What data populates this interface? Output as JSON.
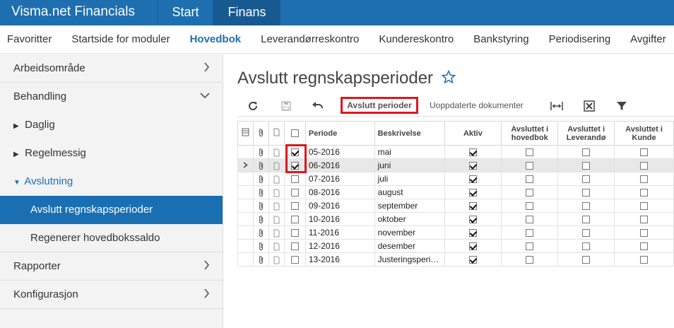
{
  "app": {
    "title": "Visma.net Financials",
    "tabs": [
      "Start",
      "Finans"
    ]
  },
  "module_nav": [
    "Favoritter",
    "Startside for moduler",
    "Hovedbok",
    "Leverandørreskontro",
    "Kundereskontro",
    "Bankstyring",
    "Periodisering",
    "Avgifter"
  ],
  "sidebar": {
    "arbeidsomrade": "Arbeidsområde",
    "behandling": "Behandling",
    "daglig": "Daglig",
    "regelmessig": "Regelmessig",
    "avslutning": "Avslutning",
    "avslutt_regnskapsperioder": "Avslutt regnskapsperioder",
    "regenerer": "Regenerer hovedbokssaldo",
    "rapporter": "Rapporter",
    "konfigurasjon": "Konfigurasjon"
  },
  "page": {
    "title": "Avslutt regnskapsperioder"
  },
  "toolbar": {
    "avslutt_perioder": "Avslutt perioder",
    "uoppdaterte": "Uoppdaterte dokumenter"
  },
  "grid": {
    "headers": {
      "periode": "Periode",
      "beskrivelse": "Beskrivelse",
      "aktiv": "Aktiv",
      "hovedbok_line1": "Avsluttet i",
      "hovedbok_line2": "hovedbok",
      "leverandor_line1": "Avsluttet i",
      "leverandor_line2": "Leverandø",
      "kunde_line1": "Avsluttet i",
      "kunde_line2": "Kunde"
    },
    "rows": [
      {
        "selected_cb": true,
        "periode": "05-2016",
        "beskrivelse": "mai",
        "aktiv": true
      },
      {
        "selected_cb": true,
        "periode": "06-2016",
        "beskrivelse": "juni",
        "aktiv": true
      },
      {
        "selected_cb": false,
        "periode": "07-2016",
        "beskrivelse": "juli",
        "aktiv": true
      },
      {
        "selected_cb": false,
        "periode": "08-2016",
        "beskrivelse": "august",
        "aktiv": true
      },
      {
        "selected_cb": false,
        "periode": "09-2016",
        "beskrivelse": "september",
        "aktiv": true
      },
      {
        "selected_cb": false,
        "periode": "10-2016",
        "beskrivelse": "oktober",
        "aktiv": true
      },
      {
        "selected_cb": false,
        "periode": "11-2016",
        "beskrivelse": "november",
        "aktiv": true
      },
      {
        "selected_cb": false,
        "periode": "12-2016",
        "beskrivelse": "desember",
        "aktiv": true
      },
      {
        "selected_cb": false,
        "periode": "13-2016",
        "beskrivelse": "Justeringsperi…",
        "aktiv": true
      }
    ]
  },
  "colors": {
    "brand": "#1e6fb0",
    "highlight": "#e0161e",
    "active_leaf": "#1a6fb3"
  }
}
